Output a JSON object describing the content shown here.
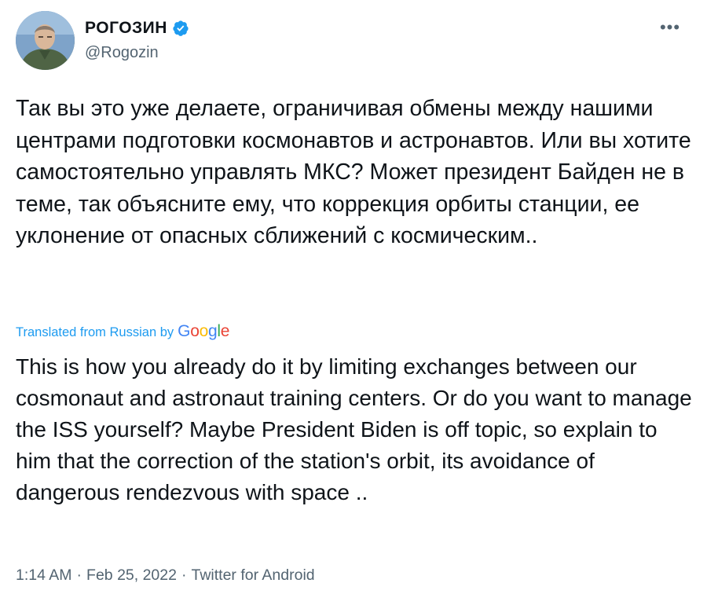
{
  "author": {
    "display_name": "РОГОЗИН",
    "handle": "@Rogozin",
    "verified": true,
    "verified_color": "#1d9bf0"
  },
  "menu": {
    "more_label": "•••"
  },
  "tweet": {
    "original_text": "Так вы это уже делаете, ограничивая обмены между нашими центрами подготовки космонавтов и астронавтов. Или вы хотите самостоятельно управлять МКС? Может президент Байден не в теме, так объясните ему, что коррекция орбиты станции, ее уклонение от опасных сближений с космическим..",
    "translation_note": "Translated from Russian by",
    "translation_provider": {
      "G1": "G",
      "o1": "o",
      "o2": "o",
      "g": "g",
      "l": "l",
      "e": "e"
    },
    "translated_text": "This is how you already do it by limiting exchanges between our cosmonaut and astronaut training centers. Or do you want to manage the ISS yourself? Maybe President Biden is off topic, so explain to him that the correction of the station's orbit, its avoidance of dangerous rendezvous with space .."
  },
  "meta": {
    "time": "1:14 AM",
    "separator": "·",
    "date": "Feb 25, 2022",
    "source": "Twitter for Android"
  },
  "colors": {
    "text": "#0f1419",
    "secondary": "#536471",
    "link": "#1d9bf0"
  }
}
